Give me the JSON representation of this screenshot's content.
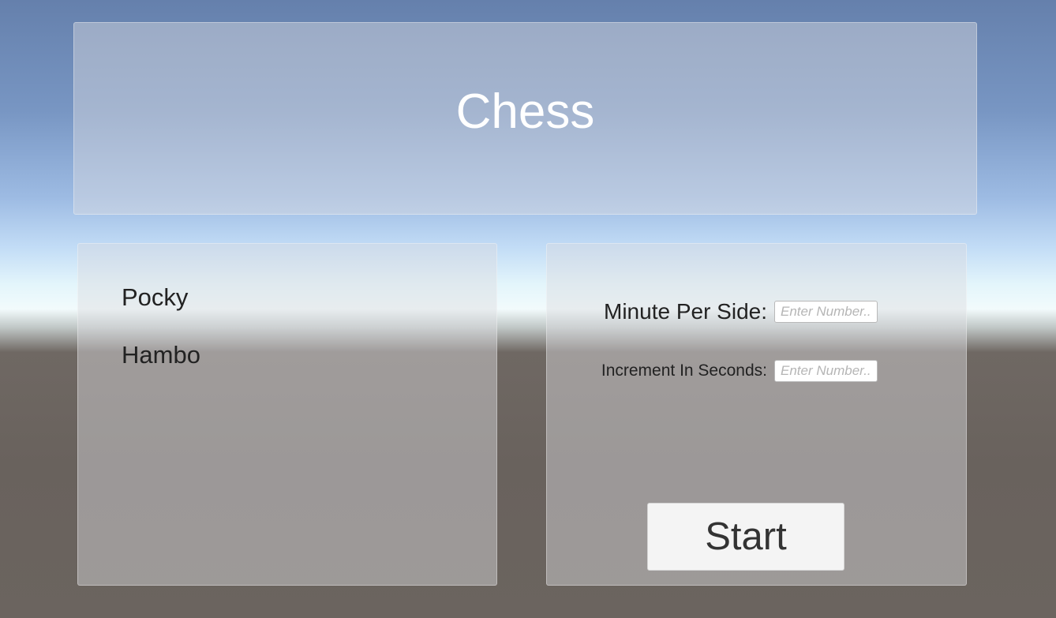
{
  "title": "Chess",
  "players": [
    {
      "name": "Pocky"
    },
    {
      "name": "Hambo"
    }
  ],
  "settings": {
    "minutes_label": "Minute Per Side:",
    "minutes_placeholder": "Enter Number...",
    "minutes_value": "",
    "increment_label": "Increment In Seconds:",
    "increment_placeholder": "Enter Number...",
    "increment_value": ""
  },
  "start_label": "Start"
}
